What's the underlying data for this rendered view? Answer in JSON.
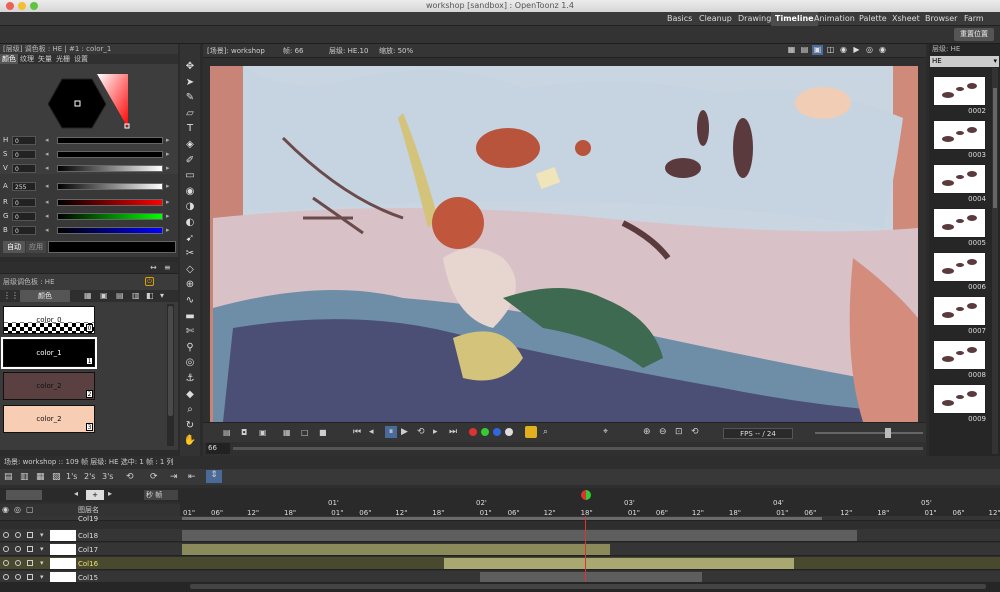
{
  "window": {
    "title": "workshop [sandbox] : OpenToonz 1.4"
  },
  "rooms": [
    "Basics",
    "Cleanup",
    "Drawing",
    "Timeline",
    "Animation",
    "Palette",
    "Xsheet",
    "Browser",
    "Farm"
  ],
  "active_room": "Timeline",
  "toolbar": {
    "reset_label": "重置位置"
  },
  "style_editor": {
    "header": "[层级] 调色板 : HE | #1 : color_1",
    "tabs": [
      "颜色",
      "纹理",
      "矢量",
      "光栅",
      "设置"
    ],
    "channels": [
      {
        "label": "H",
        "value": "0"
      },
      {
        "label": "S",
        "value": "0"
      },
      {
        "label": "V",
        "value": "0"
      },
      {
        "label": "A",
        "value": "255"
      },
      {
        "label": "R",
        "value": "0"
      },
      {
        "label": "G",
        "value": "0"
      },
      {
        "label": "B",
        "value": "0"
      }
    ],
    "auto_label": "自动",
    "apply_label": "应用"
  },
  "level_palette": {
    "header": "层级调色板 : HE",
    "mode_label": "颜色",
    "swatches": [
      {
        "name": "color_0",
        "index": "0",
        "color": "#ffffff"
      },
      {
        "name": "color_1",
        "index": "1",
        "color": "#000000"
      },
      {
        "name": "color_2",
        "index": "2",
        "color": "#5a4040"
      },
      {
        "name": "color_2",
        "index": "3",
        "color": "#f7cdb4"
      }
    ]
  },
  "viewer": {
    "header_scene": "[场景]: workshop",
    "header_frame": "帧: 66",
    "header_level": "层级: HE.10",
    "header_zoom": "缩放: 50%",
    "frame_field": "66",
    "fps_label": "FPS -- / 24"
  },
  "level_strip": {
    "header": "层级: HE",
    "level_name": "HE",
    "frames": [
      "0002",
      "0003",
      "0004",
      "0005",
      "0006",
      "0007",
      "0008",
      "0009"
    ]
  },
  "timeline": {
    "info": "场景: workshop  ::  109 帧  层级: HE  选中: 1 帧 : 1 列",
    "frame_zoom_buttons": [
      "1's",
      "2's",
      "3's"
    ],
    "frame_unit_label": "秒 帧",
    "layer_header": "图层名",
    "seconds_labels": [
      "01'",
      "02'",
      "03'",
      "04'",
      "05'"
    ],
    "frame_labels": [
      "01\"",
      "06\"",
      "12\"",
      "18\""
    ],
    "columns": [
      {
        "name": "Col19"
      },
      {
        "name": "Col18"
      },
      {
        "name": "Col17"
      },
      {
        "name": "Col16"
      },
      {
        "name": "Col15"
      }
    ]
  }
}
